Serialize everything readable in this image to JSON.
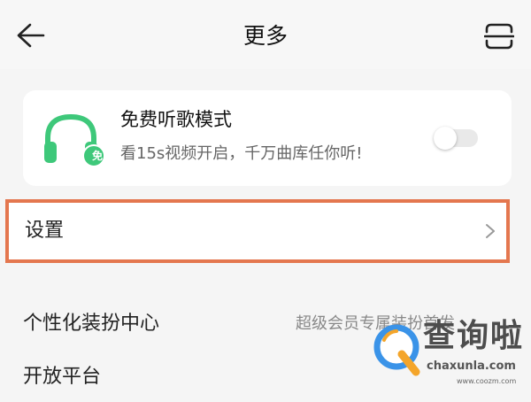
{
  "header": {
    "title": "更多",
    "back_icon": "arrow-left-icon",
    "scan_icon": "scan-icon"
  },
  "free_mode_card": {
    "title": "免费听歌模式",
    "subtitle": "看15s视频开启，千万曲库任你听!",
    "badge": "免",
    "toggle_on": false,
    "accent_color": "#3ec87a"
  },
  "settings_row": {
    "label": "设置",
    "highlight_color": "#e4774f"
  },
  "menu_items": [
    {
      "label": "个性化装扮中心",
      "value": "超级会员专属装扮首发"
    },
    {
      "label": "开放平台",
      "value": ""
    }
  ],
  "watermark": {
    "text": "查询啦",
    "domain": "chaxunla.com",
    "small": "www.coozm.com"
  }
}
